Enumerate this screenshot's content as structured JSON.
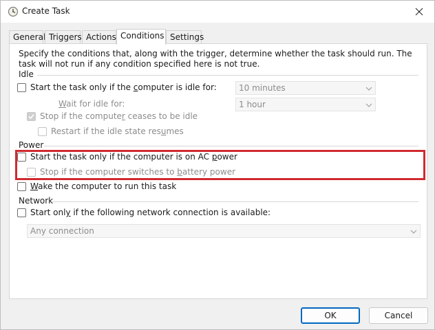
{
  "window": {
    "title": "Create Task",
    "icon": "clock-icon"
  },
  "tabs": [
    {
      "label": "General",
      "active": false
    },
    {
      "label": "Triggers",
      "active": false
    },
    {
      "label": "Actions",
      "active": false
    },
    {
      "label": "Conditions",
      "active": true
    },
    {
      "label": "Settings",
      "active": false
    }
  ],
  "conditions": {
    "description": "Specify the conditions that, along with the trigger, determine whether the task should run.  The task will not run  if any condition specified here is not true.",
    "idle": {
      "section_label": "Idle",
      "start_if_idle": {
        "label": "Start the task only if the computer is idle for:",
        "checked": false,
        "enabled": true
      },
      "idle_for_value": "10 minutes",
      "wait_label": "Wait for idle for:",
      "wait_value": "1 hour",
      "stop_if_ceases": {
        "label": "Stop if the computer ceases to be idle",
        "checked": true,
        "enabled": false
      },
      "restart_if_resumes": {
        "label": "Restart if the idle state resumes",
        "checked": false,
        "enabled": false
      }
    },
    "power": {
      "section_label": "Power",
      "start_on_ac": {
        "label": "Start the task only if the computer is on AC power",
        "checked": false,
        "enabled": true
      },
      "stop_on_battery": {
        "label": "Stop if the computer switches to battery power",
        "checked": false,
        "enabled": false
      },
      "wake_to_run": {
        "label": "Wake the computer to run this task",
        "checked": false,
        "enabled": true
      }
    },
    "network": {
      "section_label": "Network",
      "start_if_network": {
        "label": "Start only if the following network connection is available:",
        "checked": false,
        "enabled": true
      },
      "connection_value": "Any connection"
    }
  },
  "buttons": {
    "ok": "OK",
    "cancel": "Cancel"
  },
  "colors": {
    "highlight": "#cf2a2f",
    "primary_border": "#0067c0"
  }
}
